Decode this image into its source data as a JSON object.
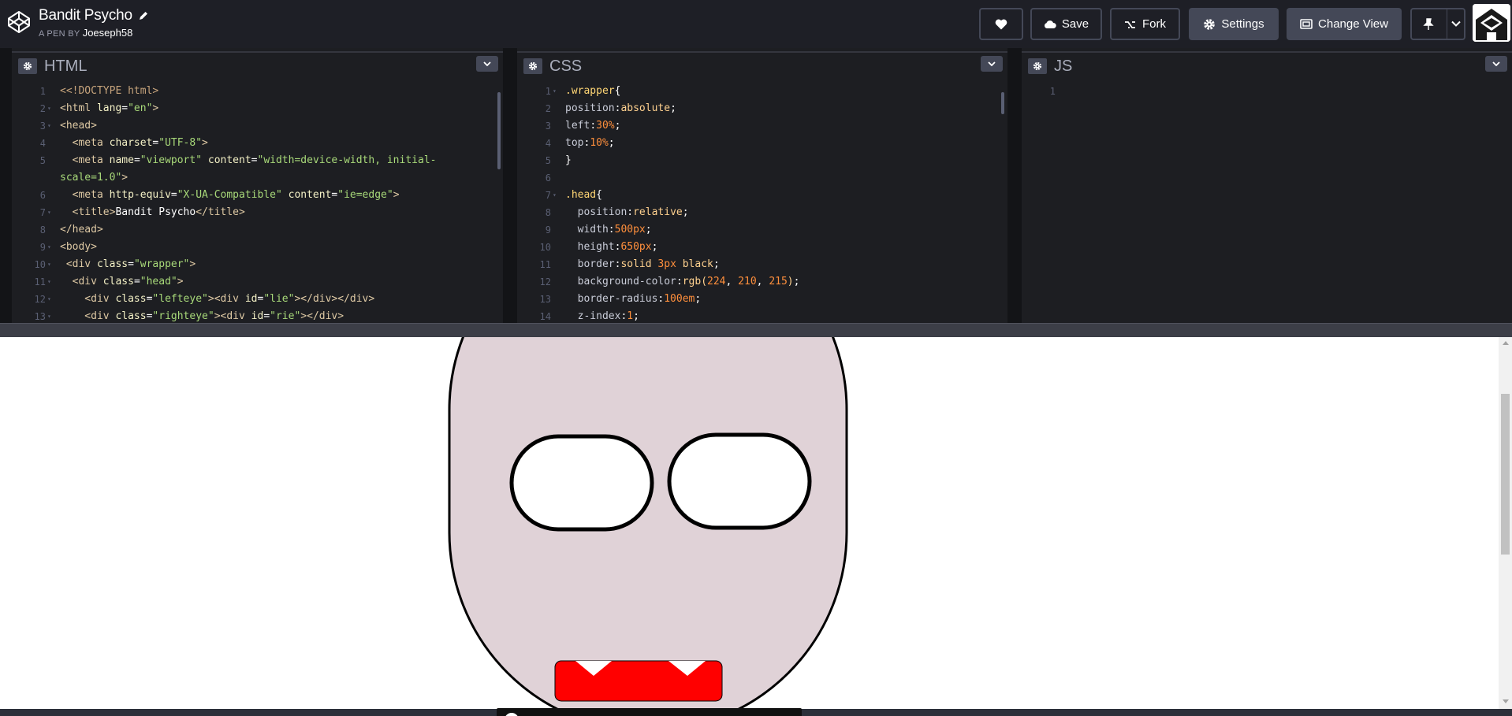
{
  "header": {
    "pen_title": "Bandit Psycho",
    "byline_prefix": "A PEN BY",
    "author": "Joeseph58",
    "buttons": {
      "heart_icon": "heart-icon",
      "save": "Save",
      "fork": "Fork",
      "settings": "Settings",
      "change_view": "Change View"
    },
    "colors": {
      "bar": "#1e1f26",
      "button_border": "#444857"
    }
  },
  "editors": {
    "html": {
      "label": "HTML",
      "lines": [
        {
          "n": "1",
          "fold": false,
          "segs": [
            [
              "doc",
              "<<!DOCTYPE html>"
            ]
          ]
        },
        {
          "n": "2",
          "fold": true,
          "segs": [
            [
              "tag",
              "<html "
            ],
            [
              "attr",
              "lang"
            ],
            [
              "punc",
              "="
            ],
            [
              "str",
              "\"en\""
            ],
            [
              "tag",
              ">"
            ]
          ]
        },
        {
          "n": "3",
          "fold": true,
          "segs": [
            [
              "tag",
              "<head>"
            ]
          ]
        },
        {
          "n": "4",
          "fold": false,
          "segs": [
            [
              "tag",
              "  <meta "
            ],
            [
              "attr",
              "charset"
            ],
            [
              "punc",
              "="
            ],
            [
              "str",
              "\"UTF-8\""
            ],
            [
              "tag",
              ">"
            ]
          ]
        },
        {
          "n": "5",
          "fold": false,
          "segs": [
            [
              "tag",
              "  <meta "
            ],
            [
              "attr",
              "name"
            ],
            [
              "punc",
              "="
            ],
            [
              "str",
              "\"viewport\""
            ],
            [
              "punc",
              " "
            ],
            [
              "attr",
              "content"
            ],
            [
              "punc",
              "="
            ],
            [
              "str",
              "\"width=device-width, initial-"
            ]
          ]
        },
        {
          "n": "",
          "fold": false,
          "segs": [
            [
              "str",
              "scale=1.0\""
            ],
            [
              "tag",
              ">"
            ]
          ]
        },
        {
          "n": "6",
          "fold": false,
          "segs": [
            [
              "tag",
              "  <meta "
            ],
            [
              "attr",
              "http-equiv"
            ],
            [
              "punc",
              "="
            ],
            [
              "str",
              "\"X-UA-Compatible\""
            ],
            [
              "punc",
              " "
            ],
            [
              "attr",
              "content"
            ],
            [
              "punc",
              "="
            ],
            [
              "str",
              "\"ie=edge\""
            ],
            [
              "tag",
              ">"
            ]
          ]
        },
        {
          "n": "7",
          "fold": true,
          "segs": [
            [
              "tag",
              "  <title>"
            ],
            [
              "punc",
              "Bandit Psycho"
            ],
            [
              "tag",
              "</title>"
            ]
          ]
        },
        {
          "n": "8",
          "fold": false,
          "segs": [
            [
              "tag",
              "</head>"
            ]
          ]
        },
        {
          "n": "9",
          "fold": true,
          "segs": [
            [
              "tag",
              "<body>"
            ]
          ]
        },
        {
          "n": "10",
          "fold": true,
          "segs": [
            [
              "tag",
              " <div "
            ],
            [
              "attr",
              "class"
            ],
            [
              "punc",
              "="
            ],
            [
              "str",
              "\"wrapper\""
            ],
            [
              "tag",
              ">"
            ]
          ]
        },
        {
          "n": "11",
          "fold": true,
          "segs": [
            [
              "tag",
              "  <div "
            ],
            [
              "attr",
              "class"
            ],
            [
              "punc",
              "="
            ],
            [
              "str",
              "\"head\""
            ],
            [
              "tag",
              ">"
            ]
          ]
        },
        {
          "n": "12",
          "fold": true,
          "segs": [
            [
              "tag",
              "    <div "
            ],
            [
              "attr",
              "class"
            ],
            [
              "punc",
              "="
            ],
            [
              "str",
              "\"lefteye\""
            ],
            [
              "tag",
              "><div "
            ],
            [
              "attr",
              "id"
            ],
            [
              "punc",
              "="
            ],
            [
              "str",
              "\"lie\""
            ],
            [
              "tag",
              "></div></div>"
            ]
          ]
        },
        {
          "n": "13",
          "fold": true,
          "segs": [
            [
              "tag",
              "    <div "
            ],
            [
              "attr",
              "class"
            ],
            [
              "punc",
              "="
            ],
            [
              "str",
              "\"righteye\""
            ],
            [
              "tag",
              "><div "
            ],
            [
              "attr",
              "id"
            ],
            [
              "punc",
              "="
            ],
            [
              "str",
              "\"rie\""
            ],
            [
              "tag",
              "></div>"
            ]
          ]
        }
      ]
    },
    "css": {
      "label": "CSS",
      "lines": [
        {
          "n": "1",
          "fold": true,
          "segs": [
            [
              "sel",
              ".wrapper"
            ],
            [
              "punc",
              "{"
            ]
          ]
        },
        {
          "n": "2",
          "fold": false,
          "segs": [
            [
              "prop",
              "position"
            ],
            [
              "punc",
              ":"
            ],
            [
              "val",
              "absolute"
            ],
            [
              "punc",
              ";"
            ]
          ]
        },
        {
          "n": "3",
          "fold": false,
          "segs": [
            [
              "prop",
              "left"
            ],
            [
              "punc",
              ":"
            ],
            [
              "num",
              "30%"
            ],
            [
              "punc",
              ";"
            ]
          ]
        },
        {
          "n": "4",
          "fold": false,
          "segs": [
            [
              "prop",
              "top"
            ],
            [
              "punc",
              ":"
            ],
            [
              "num",
              "10%"
            ],
            [
              "punc",
              ";"
            ]
          ]
        },
        {
          "n": "5",
          "fold": false,
          "segs": [
            [
              "punc",
              "}"
            ]
          ]
        },
        {
          "n": "6",
          "fold": false,
          "segs": []
        },
        {
          "n": "7",
          "fold": true,
          "segs": [
            [
              "sel",
              ".head"
            ],
            [
              "punc",
              "{"
            ]
          ]
        },
        {
          "n": "8",
          "fold": false,
          "segs": [
            [
              "prop",
              "  position"
            ],
            [
              "punc",
              ":"
            ],
            [
              "val",
              "relative"
            ],
            [
              "punc",
              ";"
            ]
          ]
        },
        {
          "n": "9",
          "fold": false,
          "segs": [
            [
              "prop",
              "  width"
            ],
            [
              "punc",
              ":"
            ],
            [
              "num",
              "500px"
            ],
            [
              "punc",
              ";"
            ]
          ]
        },
        {
          "n": "10",
          "fold": false,
          "segs": [
            [
              "prop",
              "  height"
            ],
            [
              "punc",
              ":"
            ],
            [
              "num",
              "650px"
            ],
            [
              "punc",
              ";"
            ]
          ]
        },
        {
          "n": "11",
          "fold": false,
          "segs": [
            [
              "prop",
              "  border"
            ],
            [
              "punc",
              ":"
            ],
            [
              "val",
              "solid "
            ],
            [
              "num",
              "3px"
            ],
            [
              "val",
              " black"
            ],
            [
              "punc",
              ";"
            ]
          ]
        },
        {
          "n": "12",
          "fold": false,
          "segs": [
            [
              "prop",
              "  background-color"
            ],
            [
              "punc",
              ":"
            ],
            [
              "val",
              "rgb("
            ],
            [
              "num",
              "224"
            ],
            [
              "punc",
              ", "
            ],
            [
              "num",
              "210"
            ],
            [
              "punc",
              ", "
            ],
            [
              "num",
              "215"
            ],
            [
              "val",
              ")"
            ],
            [
              "punc",
              ";"
            ]
          ]
        },
        {
          "n": "13",
          "fold": false,
          "segs": [
            [
              "prop",
              "  border-radius"
            ],
            [
              "punc",
              ":"
            ],
            [
              "num",
              "100em"
            ],
            [
              "punc",
              ";"
            ]
          ]
        },
        {
          "n": "14",
          "fold": false,
          "segs": [
            [
              "prop",
              "  z-index"
            ],
            [
              "punc",
              ":"
            ],
            [
              "num",
              "1"
            ],
            [
              "punc",
              ";"
            ]
          ]
        }
      ]
    },
    "js": {
      "label": "JS",
      "lines": [
        {
          "n": "1",
          "fold": false,
          "segs": []
        }
      ]
    }
  },
  "preview": {
    "colors": {
      "head": "#e0d2d7",
      "mouth": "#ff0000"
    }
  }
}
